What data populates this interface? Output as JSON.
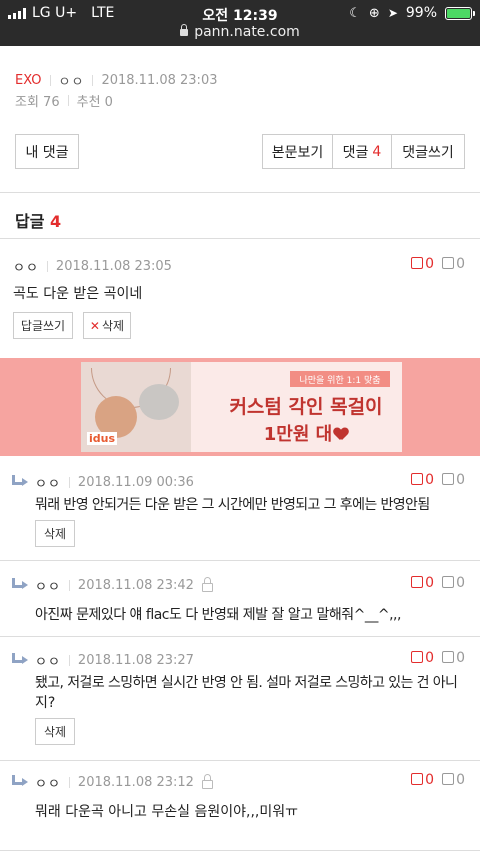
{
  "status_bar": {
    "carrier": "LG U+",
    "network": "LTE",
    "time": "오전 12:39",
    "battery": "99%",
    "battery_level": 0.99,
    "url": "pann.nate.com"
  },
  "post_meta": {
    "category": "EXO",
    "author": "ㅇㅇ",
    "date": "2018.11.08 23:03",
    "views": "조회 76",
    "recommends": "추천 0"
  },
  "buttons": {
    "my_comments": "내 댓글",
    "view_post": "본문보기",
    "comments_label": "댓글",
    "comments_count": "4",
    "write_comment": "댓글쓰기"
  },
  "replies_heading": {
    "label": "답글",
    "count": "4"
  },
  "main_comment": {
    "author": "ㅇㅇ",
    "date": "2018.11.08 23:05",
    "up": "0",
    "down": "0",
    "text": "곡도 다운 받은 곡이네",
    "reply_button": "답글쓰기",
    "delete_button": "삭제"
  },
  "ad": {
    "tag": "나만을 위한 1:1 맞춤",
    "title": "커스텀 각인 목걸이",
    "subtitle": "1만원 대",
    "brand": "idus"
  },
  "replies": [
    {
      "author": "ㅇㅇ",
      "date": "2018.11.09 00:36",
      "up": "0",
      "down": "0",
      "locked": false,
      "text": "뭐래 반영 안되거든 다운 받은 그 시간에만 반영되고 그 후에는 반영안됨",
      "delete": "삭제"
    },
    {
      "author": "ㅇㅇ",
      "date": "2018.11.08 23:42",
      "up": "0",
      "down": "0",
      "locked": true,
      "text": "아진짜 문제있다 얘 flac도 다 반영돼 제발 잘 알고 말해줘^__^,,,",
      "delete": ""
    },
    {
      "author": "ㅇㅇ",
      "date": "2018.11.08 23:27",
      "up": "0",
      "down": "0",
      "locked": false,
      "text": "됐고, 저걸로 스밍하면 실시간 반영 안 됨. 설마 저걸로 스밍하고 있는 건 아니",
      "text2": "지?",
      "delete": "삭제"
    },
    {
      "author": "ㅇㅇ",
      "date": "2018.11.08 23:12",
      "up": "0",
      "down": "0",
      "locked": true,
      "text": "뭐래 다운곡 아니고 무손실 음원이야,,,미워ㅠ",
      "delete": ""
    }
  ],
  "colors": {
    "accent": "#e32d2d",
    "status_bar": "#2b2b2b",
    "ad_bg": "#f6a4a0"
  }
}
